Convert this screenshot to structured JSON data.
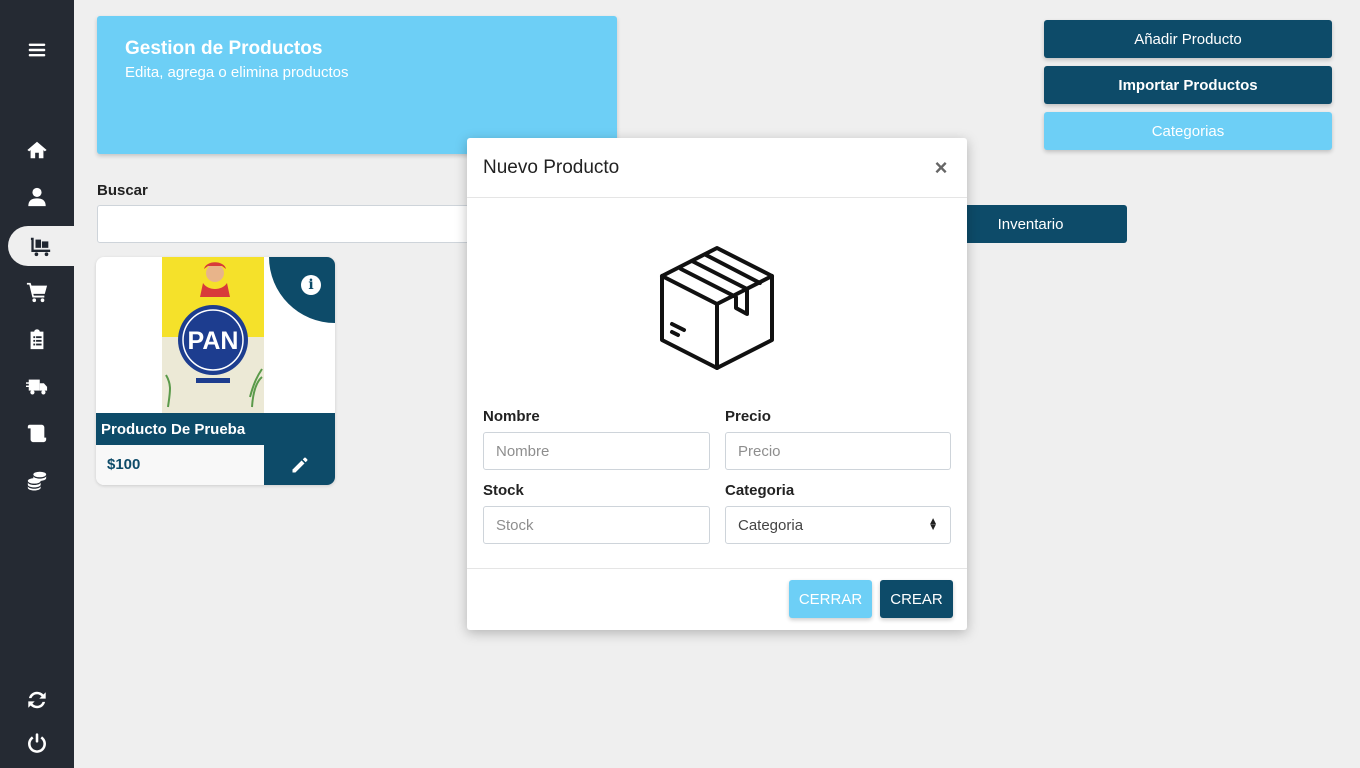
{
  "sidebar": {
    "items": [
      {
        "icon": "menu-icon"
      },
      {
        "icon": "home-icon"
      },
      {
        "icon": "user-icon"
      },
      {
        "icon": "products-cart-icon",
        "active": true
      },
      {
        "icon": "shopping-cart-icon"
      },
      {
        "icon": "clipboard-icon"
      },
      {
        "icon": "delivery-truck-icon"
      },
      {
        "icon": "scroll-icon"
      },
      {
        "icon": "coins-icon"
      },
      {
        "icon": "sync-icon"
      },
      {
        "icon": "power-icon"
      }
    ]
  },
  "header": {
    "title": "Gestion de Productos",
    "subtitle": "Edita, agrega o elimina productos"
  },
  "actions": {
    "add_product": "Añadir Producto",
    "import_products": "Importar Productos",
    "categories": "Categorias",
    "inventory": "Inventario"
  },
  "search": {
    "label": "Buscar",
    "value": ""
  },
  "product_card": {
    "name": "Producto De Prueba",
    "price": "$100",
    "image_brand": "P.A.N"
  },
  "modal": {
    "title": "Nuevo Producto",
    "close": "×",
    "fields": {
      "nombre_label": "Nombre",
      "nombre_placeholder": "Nombre",
      "precio_label": "Precio",
      "precio_placeholder": "Precio",
      "stock_label": "Stock",
      "stock_placeholder": "Stock",
      "categoria_label": "Categoria",
      "categoria_selected": "Categoria"
    },
    "buttons": {
      "cerrar": "CERRAR",
      "crear": "CREAR"
    }
  },
  "colors": {
    "sidebar": "#252a33",
    "primary_dark": "#0d4b69",
    "primary_light": "#6dcff6",
    "background": "#efefef"
  }
}
